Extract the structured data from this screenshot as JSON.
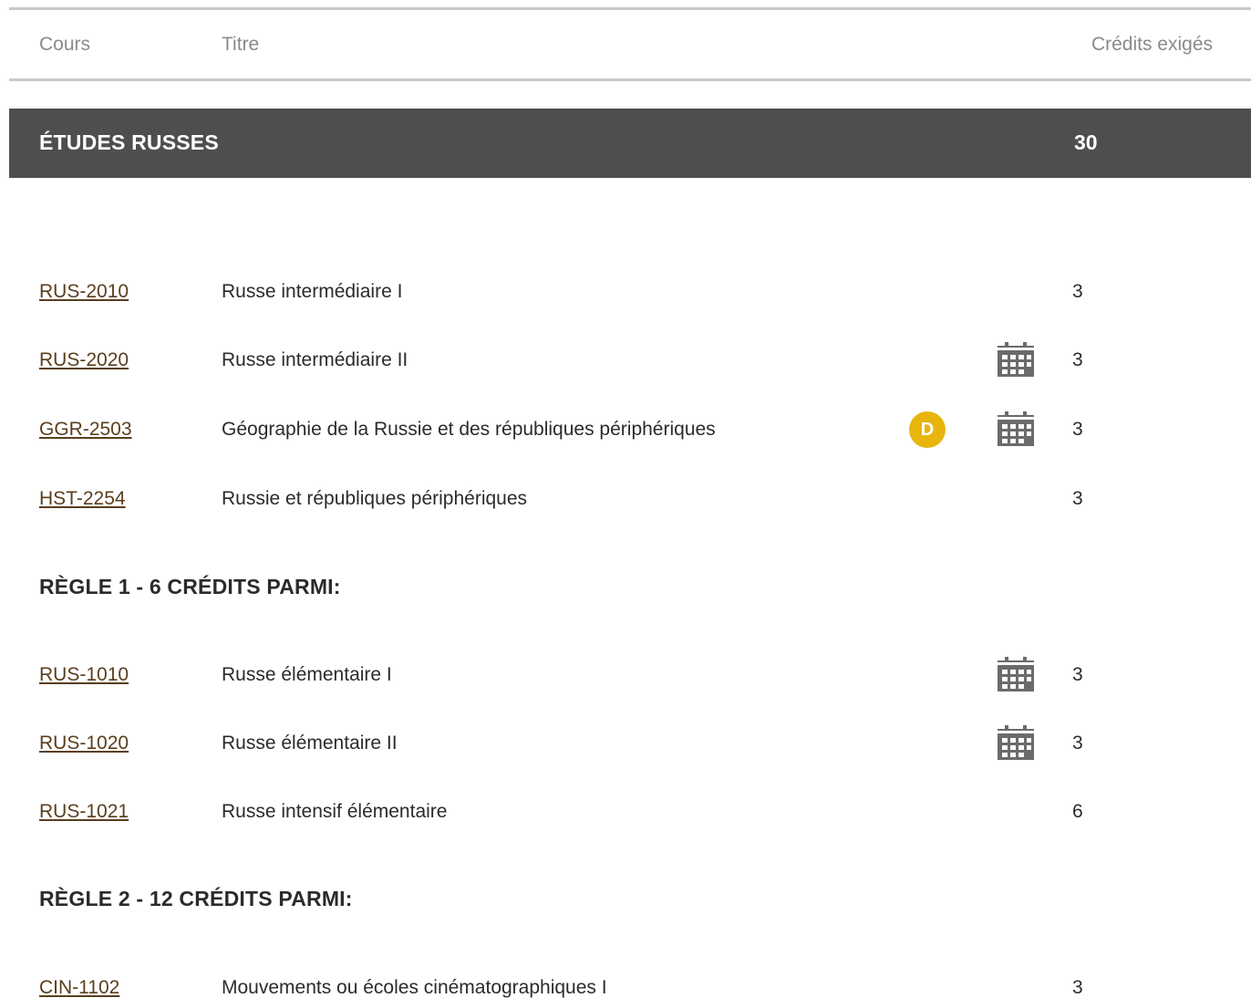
{
  "table_header": {
    "cours": "Cours",
    "titre": "Titre",
    "credits": "Crédits exigés"
  },
  "section": {
    "title": "ÉTUDES RUSSES",
    "credits": "30"
  },
  "group_main": {
    "rows": [
      {
        "code": "RUS-2010",
        "title": "Russe intermédiaire I",
        "credits": "3",
        "badge": "",
        "calendar": false
      },
      {
        "code": "RUS-2020",
        "title": "Russe intermédiaire II",
        "credits": "3",
        "badge": "",
        "calendar": true
      },
      {
        "code": "GGR-2503",
        "title": "Géographie de la Russie et des républiques périphériques",
        "credits": "3",
        "badge": "D",
        "calendar": true
      },
      {
        "code": "HST-2254",
        "title": "Russie et républiques périphériques",
        "credits": "3",
        "badge": "",
        "calendar": false
      }
    ]
  },
  "rule1": {
    "heading": "RÈGLE 1 - 6 CRÉDITS PARMI:",
    "rows": [
      {
        "code": "RUS-1010",
        "title": "Russe élémentaire I",
        "credits": "3",
        "calendar": true
      },
      {
        "code": "RUS-1020",
        "title": "Russe élémentaire II",
        "credits": "3",
        "calendar": true
      },
      {
        "code": "RUS-1021",
        "title": "Russe intensif élémentaire",
        "credits": "6",
        "calendar": false
      }
    ]
  },
  "rule2": {
    "heading": "RÈGLE 2 - 12 CRÉDITS PARMI:",
    "rows": [
      {
        "code": "CIN-1102",
        "title": "Mouvements ou écoles cinématographiques I",
        "credits": "3",
        "calendar": false
      }
    ]
  },
  "icons": {
    "calendar": "calendar-icon",
    "distance_badge": "distance-badge-icon"
  },
  "colors": {
    "section_bar": "#4e4e4e",
    "badge": "#e8b50c",
    "link": "#5a3e1e",
    "rule": "#c9c9c9"
  }
}
